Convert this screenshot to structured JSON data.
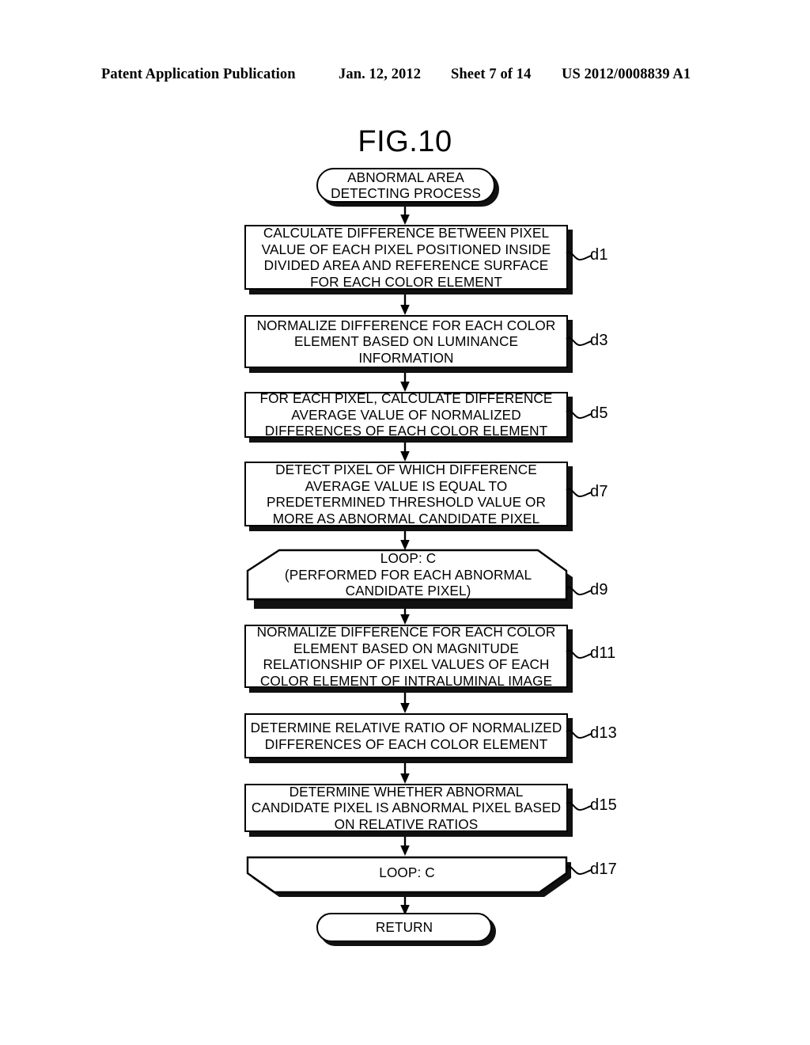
{
  "header": {
    "publication": "Patent Application Publication",
    "date": "Jan. 12, 2012",
    "sheet": "Sheet 7 of 14",
    "patent_number": "US 2012/0008839 A1"
  },
  "figure": {
    "title": "FIG.10"
  },
  "flowchart": {
    "nodes": [
      {
        "id": "start",
        "type": "terminal",
        "text": "ABNORMAL AREA\nDETECTING PROCESS",
        "ref": ""
      },
      {
        "id": "d1",
        "type": "process",
        "text": "CALCULATE DIFFERENCE BETWEEN PIXEL\nVALUE OF EACH PIXEL POSITIONED INSIDE\nDIVIDED AREA AND REFERENCE SURFACE\nFOR EACH COLOR ELEMENT",
        "ref": "d1"
      },
      {
        "id": "d3",
        "type": "process",
        "text": "NORMALIZE DIFFERENCE FOR EACH COLOR\nELEMENT BASED ON LUMINANCE\nINFORMATION",
        "ref": "d3"
      },
      {
        "id": "d5",
        "type": "process",
        "text": "FOR EACH PIXEL, CALCULATE DIFFERENCE\nAVERAGE VALUE OF NORMALIZED\nDIFFERENCES OF EACH COLOR ELEMENT",
        "ref": "d5"
      },
      {
        "id": "d7",
        "type": "process",
        "text": "DETECT PIXEL OF WHICH DIFFERENCE\nAVERAGE VALUE IS EQUAL TO\nPREDETERMINED THRESHOLD VALUE OR\nMORE AS ABNORMAL CANDIDATE PIXEL",
        "ref": "d7"
      },
      {
        "id": "d9",
        "type": "loop-start",
        "text": "LOOP: C\n(PERFORMED FOR EACH ABNORMAL\nCANDIDATE PIXEL)",
        "ref": "d9"
      },
      {
        "id": "d11",
        "type": "process",
        "text": "NORMALIZE DIFFERENCE FOR EACH COLOR\nELEMENT BASED ON MAGNITUDE\nRELATIONSHIP OF PIXEL VALUES OF EACH\nCOLOR ELEMENT OF INTRALUMINAL IMAGE",
        "ref": "d11"
      },
      {
        "id": "d13",
        "type": "process",
        "text": "DETERMINE RELATIVE RATIO OF NORMALIZED\nDIFFERENCES OF EACH COLOR ELEMENT",
        "ref": "d13"
      },
      {
        "id": "d15",
        "type": "process",
        "text": "DETERMINE WHETHER ABNORMAL\nCANDIDATE PIXEL IS ABNORMAL PIXEL BASED\nON RELATIVE RATIOS",
        "ref": "d15"
      },
      {
        "id": "d17",
        "type": "loop-end",
        "text": "LOOP: C",
        "ref": "d17"
      },
      {
        "id": "return",
        "type": "terminal",
        "text": "RETURN",
        "ref": ""
      }
    ]
  },
  "colors": {
    "line": "#000000",
    "shadow": "#111111",
    "background": "#ffffff"
  }
}
